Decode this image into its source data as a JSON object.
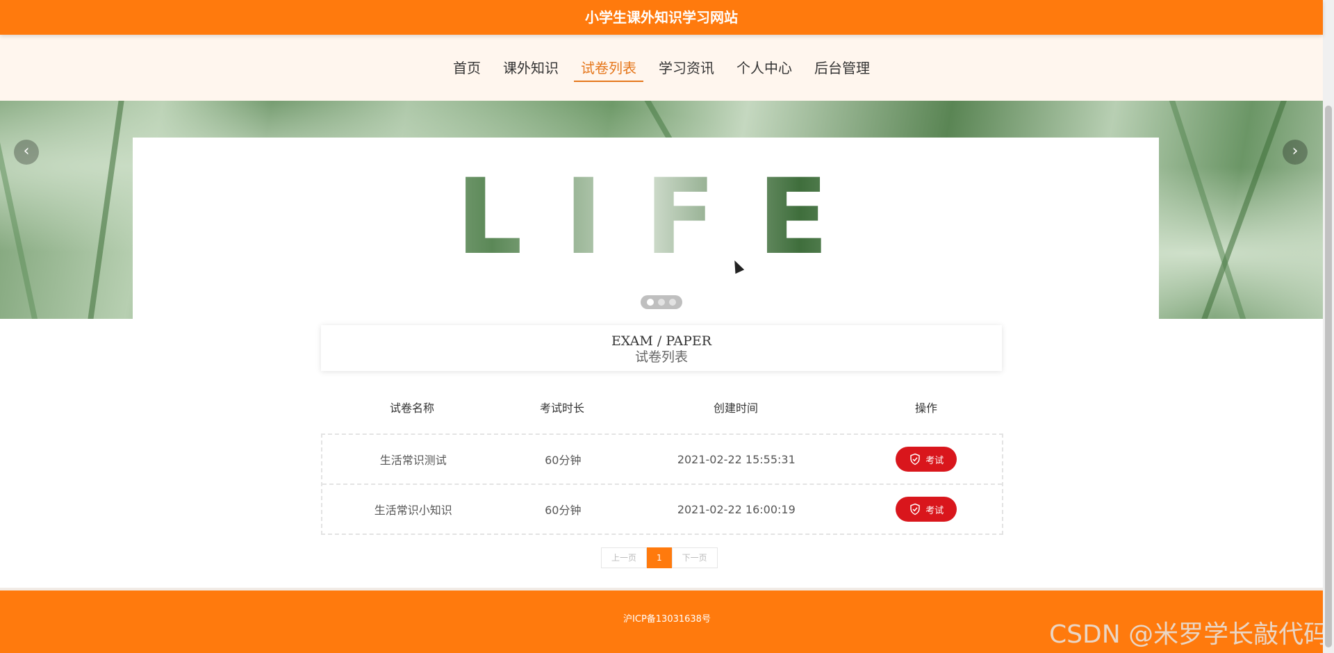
{
  "site": {
    "title": "小学生课外知识学习网站"
  },
  "nav": {
    "items": [
      {
        "label": "首页"
      },
      {
        "label": "课外知识"
      },
      {
        "label": "试卷列表"
      },
      {
        "label": "学习资讯"
      },
      {
        "label": "个人中心"
      },
      {
        "label": "后台管理"
      }
    ],
    "active": "试卷列表"
  },
  "banner": {
    "word": "LIFE",
    "prev_icon": "chevron-left-icon",
    "next_icon": "chevron-right-icon",
    "slide_count": 3,
    "active_slide": 1
  },
  "section": {
    "title_en": "EXAM / PAPER",
    "title_cn": "试卷列表"
  },
  "table": {
    "headers": [
      "试卷名称",
      "考试时长",
      "创建时间",
      "操作"
    ],
    "rows": [
      {
        "name": "生活常识测试",
        "duration": "60分钟",
        "created": "2021-02-22 15:55:31",
        "action": "考试"
      },
      {
        "name": "生活常识小知识",
        "duration": "60分钟",
        "created": "2021-02-22 16:00:19",
        "action": "考试"
      }
    ],
    "action_icon": "shield-check-icon"
  },
  "pagination": {
    "prev_label": "上一页",
    "current_page": "1",
    "next_label": "下一页"
  },
  "footer": {
    "icp": "沪ICP备13031638号"
  },
  "watermark": "CSDN @米罗学长敲代码",
  "colors": {
    "brand": "#ff7a0d",
    "nav_active": "#e5761a",
    "exam_button": "#d9161c"
  }
}
